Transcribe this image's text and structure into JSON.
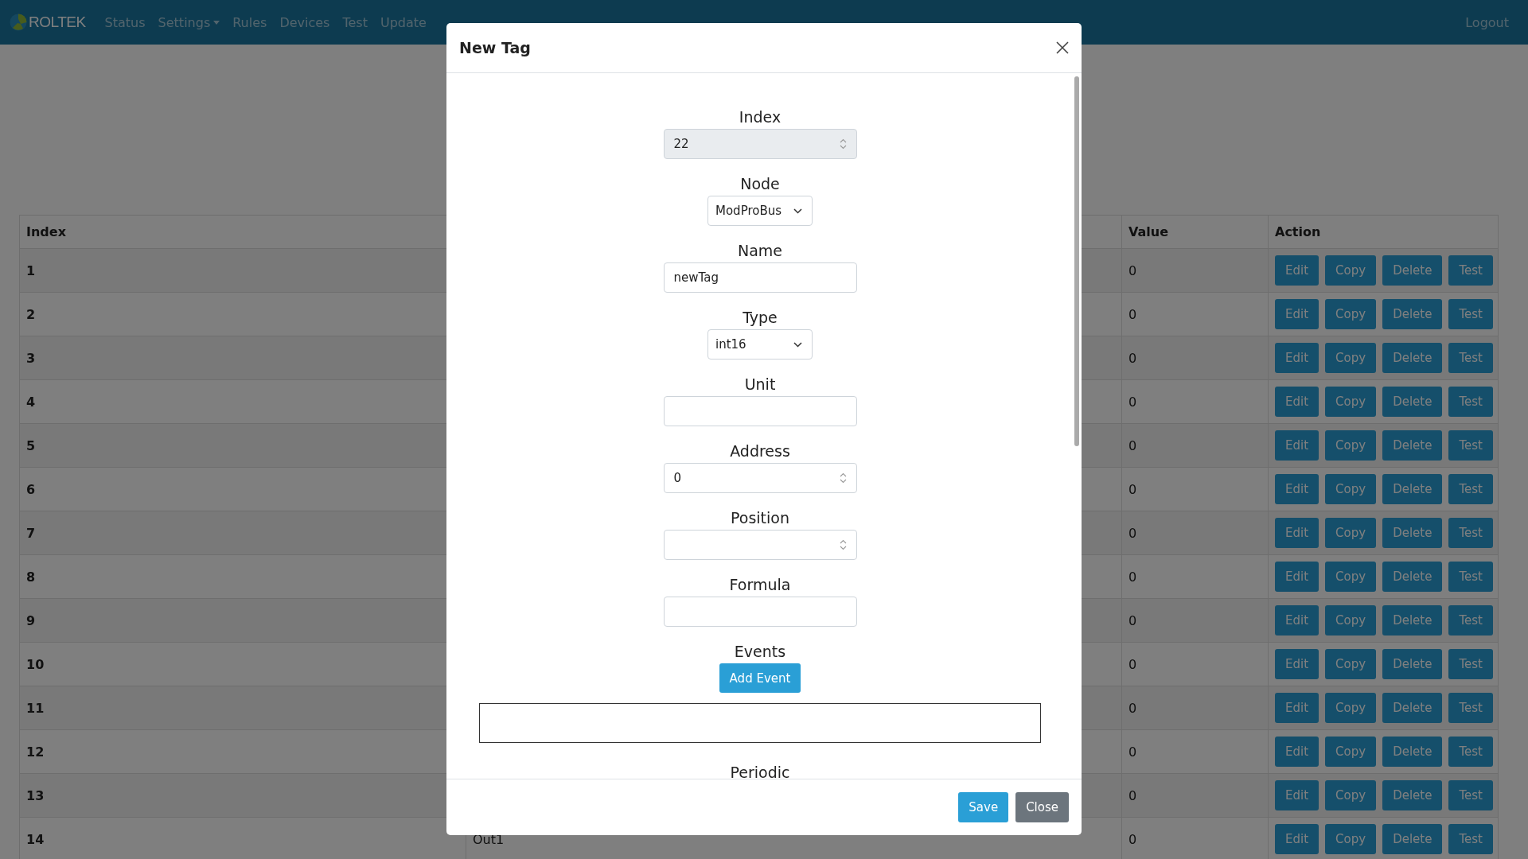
{
  "navbar": {
    "brand": "ROLTEK",
    "items": [
      {
        "label": "Status",
        "kind": "link"
      },
      {
        "label": "Settings",
        "kind": "dropdown"
      },
      {
        "label": "Rules",
        "kind": "link"
      },
      {
        "label": "Devices",
        "kind": "link"
      },
      {
        "label": "Test",
        "kind": "link"
      },
      {
        "label": "Update",
        "kind": "link"
      }
    ],
    "logout": "Logout"
  },
  "table": {
    "columns": {
      "index": "Index",
      "value": "Value",
      "action": "Action"
    },
    "rows": [
      {
        "index": "1",
        "value": "0",
        "actions": [
          "Edit",
          "Copy",
          "Delete",
          "Test"
        ]
      },
      {
        "index": "2",
        "value": "0",
        "actions": [
          "Edit",
          "Copy",
          "Delete",
          "Test"
        ]
      },
      {
        "index": "3",
        "value": "0",
        "actions": [
          "Edit",
          "Copy",
          "Delete",
          "Test"
        ]
      },
      {
        "index": "4",
        "value": "0",
        "actions": [
          "Edit",
          "Copy",
          "Delete",
          "Test"
        ]
      },
      {
        "index": "5",
        "value": "0",
        "actions": [
          "Edit",
          "Copy",
          "Delete",
          "Test"
        ]
      },
      {
        "index": "6",
        "value": "0",
        "actions": [
          "Edit",
          "Copy",
          "Delete",
          "Test"
        ]
      },
      {
        "index": "7",
        "value": "0",
        "actions": [
          "Edit",
          "Copy",
          "Delete",
          "Test"
        ]
      },
      {
        "index": "8",
        "value": "0",
        "actions": [
          "Edit",
          "Copy",
          "Delete",
          "Test"
        ]
      },
      {
        "index": "9",
        "value": "0",
        "actions": [
          "Edit",
          "Copy",
          "Delete",
          "Test"
        ]
      },
      {
        "index": "10",
        "value": "0",
        "actions": [
          "Edit",
          "Copy",
          "Delete",
          "Test"
        ]
      },
      {
        "index": "11",
        "value": "0",
        "actions": [
          "Edit",
          "Copy",
          "Delete",
          "Test"
        ]
      },
      {
        "index": "12",
        "value": "0",
        "actions": [
          "Edit",
          "Copy",
          "Delete",
          "Test"
        ]
      },
      {
        "index": "13",
        "value": "0",
        "actions": [
          "Edit",
          "Copy",
          "Delete",
          "Test"
        ]
      },
      {
        "index": "14",
        "name": "Out1",
        "value": "0",
        "actions": [
          "Edit",
          "Copy",
          "Delete",
          "Test"
        ]
      }
    ]
  },
  "modal": {
    "title": "New Tag",
    "fields": [
      {
        "label": "Index",
        "kind": "number",
        "value": "22",
        "disabled": true
      },
      {
        "label": "Node",
        "kind": "select",
        "value": "ModProBus",
        "disabled": false
      },
      {
        "label": "Name",
        "kind": "text",
        "value": "newTag",
        "disabled": false
      },
      {
        "label": "Type",
        "kind": "select",
        "value": "int16",
        "disabled": false
      },
      {
        "label": "Unit",
        "kind": "text",
        "disabled": false
      },
      {
        "label": "Address",
        "kind": "number",
        "value": "0",
        "disabled": false
      },
      {
        "label": "Position",
        "kind": "number",
        "disabled": false
      },
      {
        "label": "Formula",
        "kind": "text",
        "disabled": false
      }
    ],
    "events": {
      "label": "Events",
      "button": "Add Event"
    },
    "periodic_label": "Periodic",
    "buttons": [
      {
        "label": "Save",
        "kind": "primary"
      },
      {
        "label": "Close",
        "kind": "secondary"
      }
    ]
  }
}
